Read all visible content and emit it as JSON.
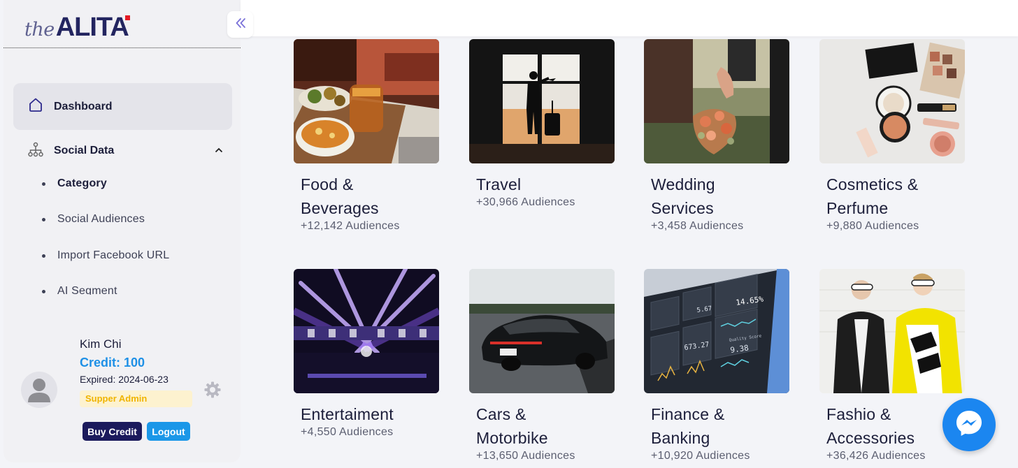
{
  "app": {
    "logo_prefix": "the",
    "logo_name": "ALITA"
  },
  "sidebar": {
    "nav": {
      "dashboard_label": "Dashboard",
      "social_data_label": "Social Data",
      "social_sub_items": [
        {
          "label": "Category",
          "active": true
        },
        {
          "label": "Social Audiences",
          "active": false
        },
        {
          "label": "Import Facebook URL",
          "active": false
        },
        {
          "label": "AI Segment",
          "active": false
        }
      ]
    },
    "profile": {
      "name": "Kim Chi",
      "credit": "Credit: 100",
      "expired": "Expired: 2024-06-23",
      "role": "Supper Admin",
      "buy_credit_label": "Buy Credit",
      "logout_label": "Logout"
    }
  },
  "categories": [
    {
      "title_line1": "Food &",
      "title_line2": "Beverages",
      "audiences": "+12,142 Audiences",
      "image_icon": "food-photo"
    },
    {
      "title_line1": "Travel",
      "title_line2": "",
      "audiences": "+30,966 Audiences",
      "image_icon": "travel-photo"
    },
    {
      "title_line1": "Wedding",
      "title_line2": "Services",
      "audiences": "+3,458 Audiences",
      "image_icon": "wedding-photo"
    },
    {
      "title_line1": "Cosmetics &",
      "title_line2": "Perfume",
      "audiences": "+9,880 Audiences",
      "image_icon": "cosmetics-photo"
    },
    {
      "title_line1": "Entertaiment",
      "title_line2": "",
      "audiences": "+4,550 Audiences",
      "image_icon": "concert-photo"
    },
    {
      "title_line1": "Cars &",
      "title_line2": "Motorbike",
      "audiences": "+13,650 Audiences",
      "image_icon": "car-photo"
    },
    {
      "title_line1": "Finance &",
      "title_line2": "Banking",
      "audiences": "+10,920 Audiences",
      "image_icon": "finance-photo"
    },
    {
      "title_line1": "Fashio &",
      "title_line2": "Accessories",
      "audiences": "+36,426 Audiences",
      "image_icon": "fashion-photo"
    }
  ],
  "finance_photo_text": {
    "value_top": "14.65%",
    "value_left": "5.67",
    "value_mid": "673.27",
    "quality_score_label": "Quality Score",
    "quality_score_value": "9.38"
  },
  "colors": {
    "accent_blue": "#1e90e6",
    "brand_navy": "#232560",
    "brand_red": "#e51b24",
    "badge_bg": "#fdf2cf",
    "badge_text": "#f0b400",
    "messenger_blue": "#1b86f0"
  }
}
